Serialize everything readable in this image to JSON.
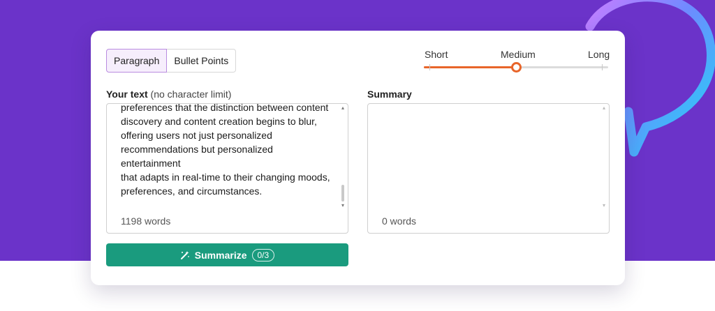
{
  "modes": [
    {
      "label": "Paragraph",
      "active": true
    },
    {
      "label": "Bullet Points",
      "active": false
    }
  ],
  "length": {
    "options": [
      "Short",
      "Medium",
      "Long"
    ],
    "selected": "Medium",
    "position_fraction": 0.5
  },
  "input_panel": {
    "title": "Your text",
    "hint": "(no character limit)",
    "lines": [
      "preferences that the distinction between content",
      "discovery and content creation begins to blur,",
      "offering users not just personalized",
      "recommendations but personalized entertainment",
      "that adapts in real-time to their changing moods,",
      "preferences, and circumstances."
    ],
    "word_count": "1198 words"
  },
  "summary_panel": {
    "title": "Summary",
    "word_count": "0 words"
  },
  "summarize_button": {
    "label": "Summarize",
    "usage": "0/3",
    "icon": "wand-icon"
  },
  "colors": {
    "background_purple": "#6b33c9",
    "accent_orange": "#e8652a",
    "button_green": "#1a9b7e",
    "active_mode_border": "#b98be0"
  }
}
